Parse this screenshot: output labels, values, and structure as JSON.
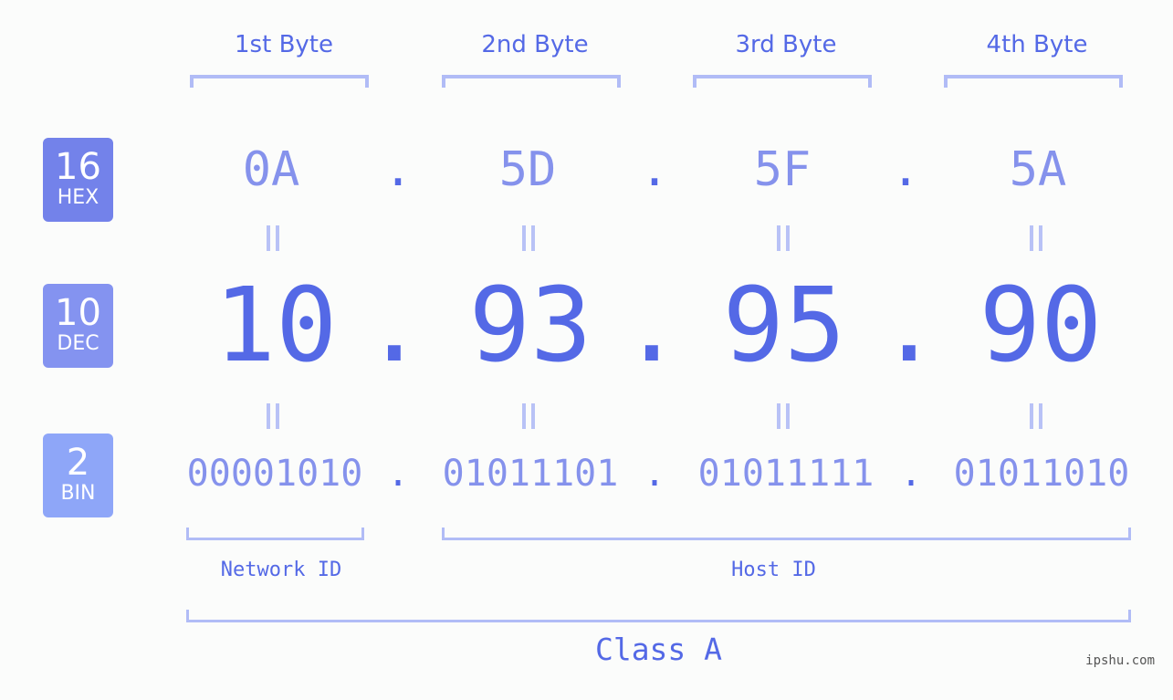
{
  "bytes": {
    "labels": [
      "1st Byte",
      "2nd Byte",
      "3rd Byte",
      "4th Byte"
    ]
  },
  "badges": {
    "hex": {
      "base": "16",
      "label": "HEX",
      "color": "#7382ea"
    },
    "dec": {
      "base": "10",
      "label": "DEC",
      "color": "#8493f0"
    },
    "bin": {
      "base": "2",
      "label": "BIN",
      "color": "#8ea6f8"
    }
  },
  "ip": {
    "hex": [
      "0A",
      "5D",
      "5F",
      "5A"
    ],
    "dec": [
      "10",
      "93",
      "95",
      "90"
    ],
    "bin": [
      "00001010",
      "01011101",
      "01011111",
      "01011010"
    ],
    "separator": "."
  },
  "segments": {
    "network_id": "Network ID",
    "host_id": "Host ID",
    "class": "Class A"
  },
  "watermark": "ipshu.com",
  "colors": {
    "accent": "#5469e6",
    "light": "#8592ec",
    "bracket": "#b1bcf6",
    "background": "#fbfcfb"
  }
}
